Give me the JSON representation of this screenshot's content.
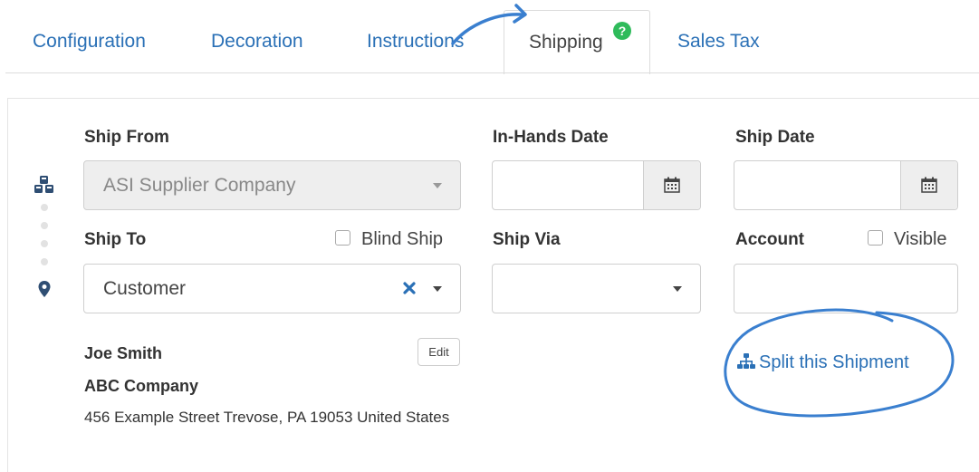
{
  "tabs": {
    "items": [
      {
        "label": "Configuration"
      },
      {
        "label": "Decoration"
      },
      {
        "label": "Instructions"
      },
      {
        "label": "Shipping",
        "badge": "?"
      },
      {
        "label": "Sales Tax"
      }
    ],
    "active": "Shipping"
  },
  "form": {
    "ship_from": {
      "label": "Ship From",
      "value": "ASI Supplier Company"
    },
    "in_hands_date": {
      "label": "In-Hands Date",
      "value": ""
    },
    "ship_date": {
      "label": "Ship Date",
      "value": ""
    },
    "ship_to": {
      "label": "Ship To",
      "value": "Customer"
    },
    "blind_ship": {
      "label": "Blind Ship",
      "checked": false
    },
    "ship_via": {
      "label": "Ship Via",
      "value": ""
    },
    "account": {
      "label": "Account",
      "value": ""
    },
    "visible": {
      "label": "Visible",
      "checked": false
    }
  },
  "address": {
    "name": "Joe Smith",
    "company": "ABC Company",
    "line": "456 Example Street Trevose, PA 19053 United States",
    "edit_label": "Edit"
  },
  "split_label": "Split this Shipment",
  "icons": {
    "steps_top": "cubes-icon",
    "steps_bottom": "map-marker-icon",
    "calendar": "calendar-icon",
    "split": "sitemap-icon",
    "clear": "times-icon",
    "help": "question-badge"
  },
  "colors": {
    "accent": "#2a70b6",
    "badge": "#2fbb5b",
    "annotation": "#3a7fcf"
  }
}
